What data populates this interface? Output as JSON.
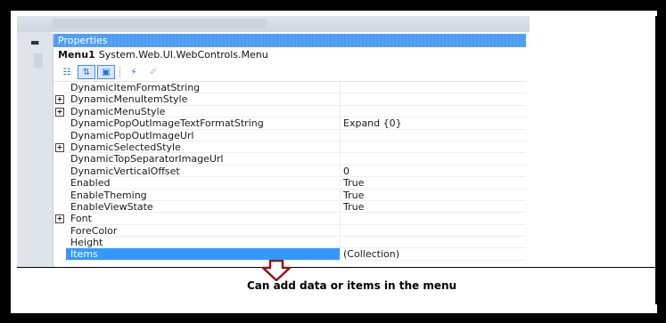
{
  "panel": {
    "title": "Properties",
    "object_name": "Menu1",
    "object_type": "System.Web.UI.WebControls.Menu"
  },
  "toolbar": {
    "buttons": [
      {
        "icon": "categorized-icon",
        "glyph": "☷",
        "active": false
      },
      {
        "icon": "alphabetical-icon",
        "glyph": "⇅",
        "active": true
      },
      {
        "icon": "properties-icon",
        "glyph": "▣",
        "active": true
      },
      {
        "icon": "events-icon",
        "glyph": "⚡",
        "active": false
      },
      {
        "icon": "property-pages-icon",
        "glyph": "✐",
        "active": false,
        "disabled": true
      }
    ]
  },
  "properties": [
    {
      "name": "DynamicItemFormatString",
      "value": "",
      "expandable": false
    },
    {
      "name": "DynamicMenuItemStyle",
      "value": "",
      "expandable": true
    },
    {
      "name": "DynamicMenuStyle",
      "value": "",
      "expandable": true
    },
    {
      "name": "DynamicPopOutImageTextFormatString",
      "value": "Expand {0}",
      "expandable": false
    },
    {
      "name": "DynamicPopOutImageUrl",
      "value": "",
      "expandable": false
    },
    {
      "name": "DynamicSelectedStyle",
      "value": "",
      "expandable": true
    },
    {
      "name": "DynamicTopSeparatorImageUrl",
      "value": "",
      "expandable": false
    },
    {
      "name": "DynamicVerticalOffset",
      "value": "0",
      "expandable": false
    },
    {
      "name": "Enabled",
      "value": "True",
      "expandable": false
    },
    {
      "name": "EnableTheming",
      "value": "True",
      "expandable": false
    },
    {
      "name": "EnableViewState",
      "value": "True",
      "expandable": false
    },
    {
      "name": "Font",
      "value": "",
      "expandable": true
    },
    {
      "name": "ForeColor",
      "value": "",
      "expandable": false
    },
    {
      "name": "Height",
      "value": "",
      "expandable": false
    },
    {
      "name": "Items",
      "value": "(Collection)",
      "expandable": false,
      "selected": true
    }
  ],
  "annotation": {
    "caption": "Can add data or items in the menu",
    "arrow_color": "#8b1a1a"
  },
  "colors": {
    "title_bar": "#4a9bf5",
    "selection": "#3399ff"
  }
}
